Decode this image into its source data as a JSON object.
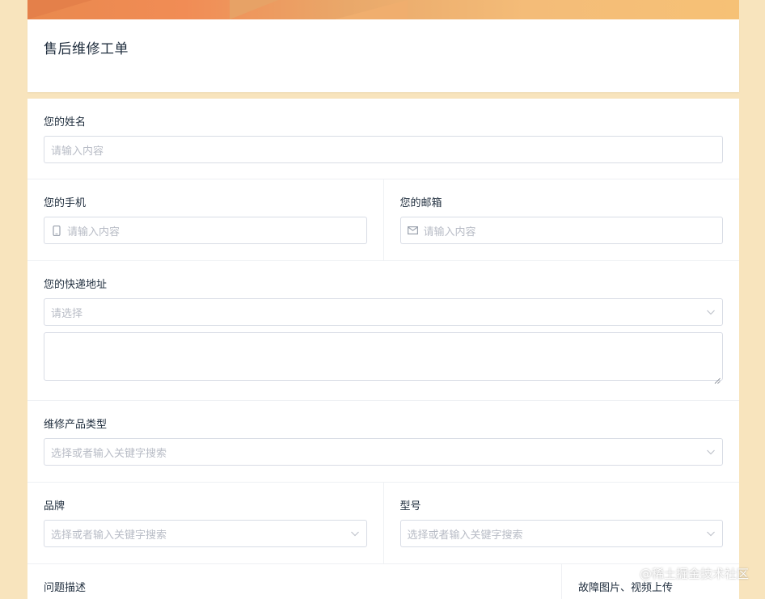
{
  "form": {
    "title": "售后维修工单"
  },
  "fields": {
    "name": {
      "label": "您的姓名",
      "placeholder": "请输入内容"
    },
    "phone": {
      "label": "您的手机",
      "placeholder": "请输入内容",
      "icon": "mobile-icon"
    },
    "email": {
      "label": "您的邮箱",
      "placeholder": "请输入内容",
      "icon": "mail-icon"
    },
    "address": {
      "label": "您的快递地址",
      "placeholder": "请选择",
      "icon": "chevron-down-icon"
    },
    "product_type": {
      "label": "维修产品类型",
      "placeholder": "选择或者输入关键字搜索"
    },
    "brand": {
      "label": "品牌",
      "placeholder": "选择或者输入关键字搜索"
    },
    "model": {
      "label": "型号",
      "placeholder": "选择或者输入关键字搜索"
    },
    "problem": {
      "label": "问题描述"
    },
    "upload": {
      "label": "故障图片、视频上传"
    }
  },
  "watermark": "@稀土掘金技术社区",
  "colors": {
    "background": "#f8e4bd",
    "accent": "#f18c55",
    "border": "#d8dce5",
    "placeholder": "#b8bcc6"
  }
}
